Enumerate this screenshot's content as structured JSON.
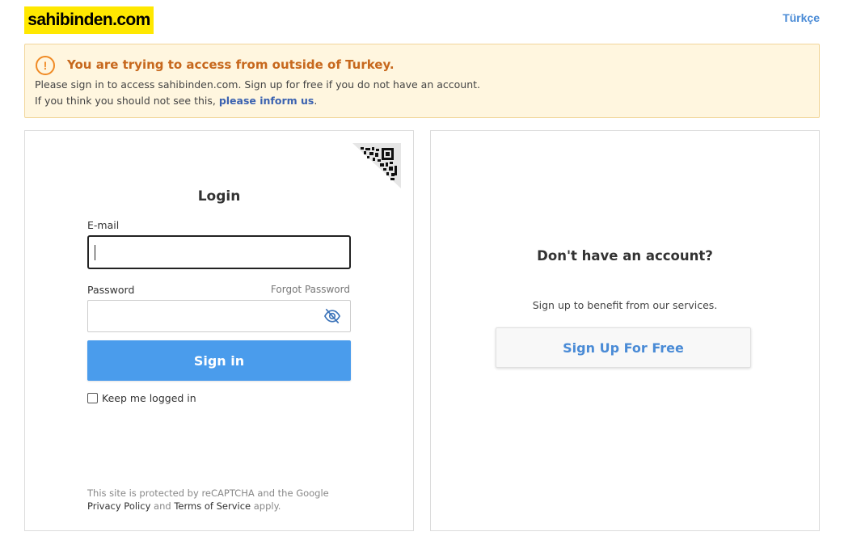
{
  "header": {
    "logo_text": "sahibinden.com",
    "language_link": "Türkçe",
    "logo_color": "#ffe800"
  },
  "warning": {
    "icon": "exclamation-circle-icon",
    "icon_glyph": "!",
    "title": "You are trying to access from outside of Turkey.",
    "line1": "Please sign in to access sahibinden.com. Sign up for free if you do not have an account.",
    "line2_prefix": "If you think you should not see this, ",
    "line2_link": "please inform us",
    "line2_suffix": "."
  },
  "login": {
    "title": "Login",
    "email_label": "E-mail",
    "email_value": "",
    "password_label": "Password",
    "forgot_password": "Forgot Password",
    "password_value": "",
    "password_toggle_icon": "eye-slash-icon",
    "signin_label": "Sign in",
    "keep_logged_in": "Keep me logged in",
    "keep_logged_in_checked": false,
    "qr_icon": "qr-code-icon",
    "recaptcha_text": "This site is protected by reCAPTCHA and the Google",
    "privacy_policy": "Privacy Policy",
    "and_text": "and",
    "terms_of_service": "Terms of Service",
    "apply_text": "apply.",
    "accent_color": "#4a9cec"
  },
  "signup": {
    "title": "Don't have an account?",
    "subtitle": "Sign up to benefit from our services.",
    "button_label": "Sign Up For Free"
  }
}
